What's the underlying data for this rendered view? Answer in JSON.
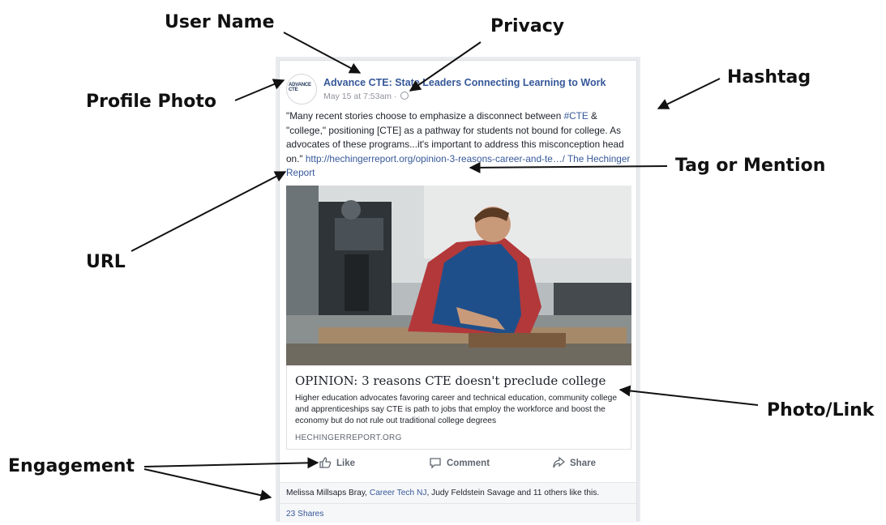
{
  "callouts": {
    "user_name": "User Name",
    "privacy": "Privacy",
    "hashtag": "Hashtag",
    "profile_photo": "Profile Photo",
    "tag_or_mention": "Tag or Mention",
    "url": "URL",
    "photo_link": "Photo/Link",
    "engagement": "Engagement"
  },
  "post": {
    "avatar_logo_text": "ADVANCE CTE",
    "page_name": "Advance CTE: State Leaders Connecting Learning to Work",
    "timestamp": "May 15 at 7:53am",
    "meta_separator": "·",
    "privacy_icon": "globe-icon",
    "text_part1": "\"Many recent stories choose to emphasize a disconnect between ",
    "hashtag": "#CTE",
    "text_part2": " & \"college,\" positioning [CTE] as a pathway for students not bound for college. As advocates of these programs...it's important to address this misconception head on.\" ",
    "url": "http://hechingerreport.org/opinion-3-reasons-career-and-te…/",
    "mention": " The Hechinger Report",
    "photo_icon": "student-machining-photo"
  },
  "preview": {
    "title": "OPINION: 3 reasons CTE doesn't preclude college",
    "description": "Higher education advocates favoring career and technical education, community college and apprenticeships say CTE is path to jobs that employ the workforce and boost the economy but do not rule out traditional college degrees",
    "domain": "HECHINGERREPORT.ORG"
  },
  "actions": {
    "like": "Like",
    "comment": "Comment",
    "share": "Share"
  },
  "engagement": {
    "likes_part1": "Melissa Millsaps Bray, ",
    "likes_link": "Career Tech NJ",
    "likes_part2": ", Judy Feldstein Savage and 11 others like this.",
    "shares": "23 Shares"
  },
  "colors": {
    "link": "#365899",
    "page_bg": "#e9ebee",
    "text": "#1d2129",
    "muted": "#90949c"
  }
}
